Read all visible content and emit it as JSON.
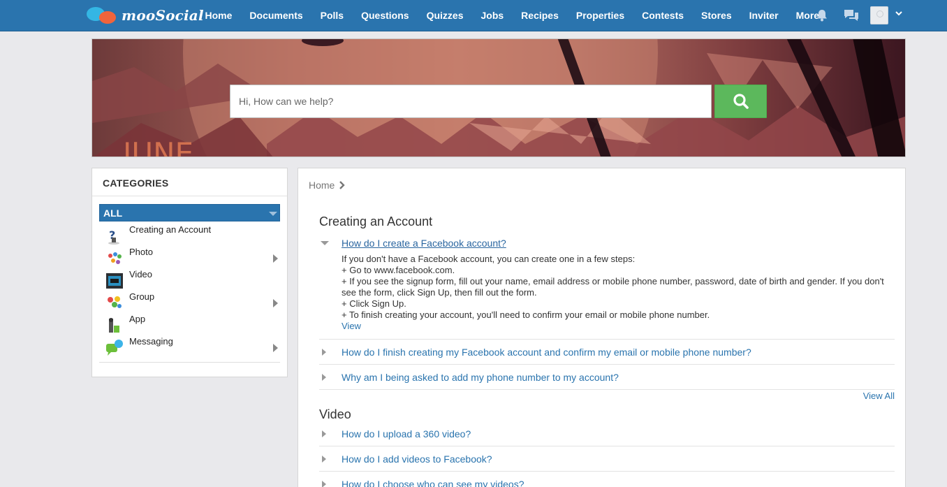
{
  "brand": {
    "name": "mooSocial"
  },
  "nav": {
    "items": [
      "Home",
      "Documents",
      "Polls",
      "Questions",
      "Quizzes",
      "Jobs",
      "Recipes",
      "Properties",
      "Contests",
      "Stores",
      "Inviter",
      "More"
    ]
  },
  "banner": {
    "search_placeholder": "Hi, How can we help?",
    "artwork_text": "JUNE"
  },
  "sidebar": {
    "title": "CATEGORIES",
    "all_label": "ALL",
    "items": [
      {
        "label": "Creating an Account",
        "icon": "question-figure-icon",
        "has_children": false
      },
      {
        "label": "Photo",
        "icon": "photo-people-icon",
        "has_children": true
      },
      {
        "label": "Video",
        "icon": "video-clapper-icon",
        "has_children": false
      },
      {
        "label": "Group",
        "icon": "group-balloons-icon",
        "has_children": true
      },
      {
        "label": "App",
        "icon": "app-figure-icon",
        "has_children": false
      },
      {
        "label": "Messaging",
        "icon": "messaging-bubbles-icon",
        "has_children": true
      }
    ]
  },
  "main": {
    "breadcrumb": "Home",
    "sections": [
      {
        "title": "Creating an Account",
        "questions": [
          "How do I create a Facebook account?",
          "How do I finish creating my Facebook account and confirm my email or mobile phone number?",
          "Why am I being asked to add my phone number to my account?"
        ],
        "answer_lines": [
          "If you don't have a Facebook account, you can create one in a few steps:",
          " + Go to www.facebook.com.",
          " + If you see the signup form, fill out your name, email address or mobile phone number, password, date of birth and gender. If you don't see the form, click Sign Up, then fill out the form.",
          " + Click Sign Up.",
          " + To finish creating your account, you'll need to confirm your email or mobile phone number."
        ],
        "answer_link": "View",
        "view_all": "View All"
      },
      {
        "title": "Video",
        "questions": [
          "How do I upload a 360 video?",
          "How do I add videos to Facebook?",
          "How do I choose who can see my videos?"
        ]
      }
    ]
  },
  "colors": {
    "topbar": "#2a74ae",
    "search_button": "#5cb85c",
    "link": "#2a74ae"
  }
}
